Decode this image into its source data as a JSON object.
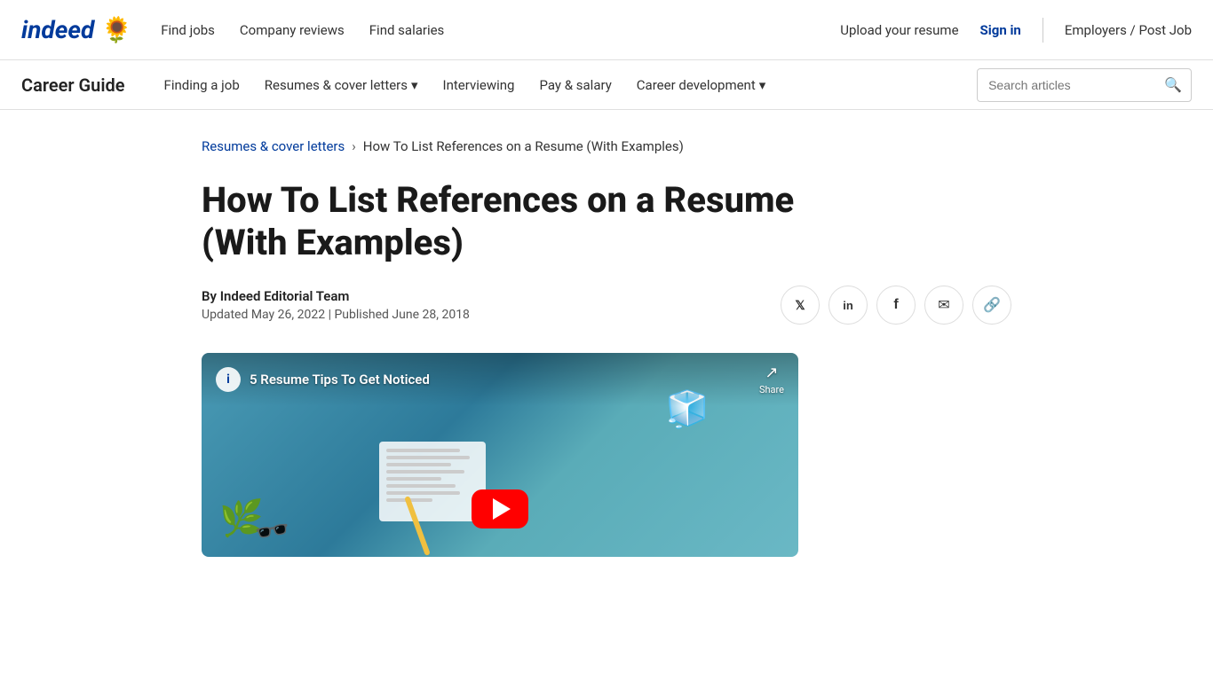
{
  "topNav": {
    "logo_text": "indeed",
    "logo_flower": "🌻",
    "links": [
      {
        "id": "find-jobs",
        "label": "Find jobs"
      },
      {
        "id": "company-reviews",
        "label": "Company reviews"
      },
      {
        "id": "find-salaries",
        "label": "Find salaries"
      }
    ],
    "right": {
      "upload_resume": "Upload your resume",
      "sign_in": "Sign in",
      "employers": "Employers / Post Job"
    }
  },
  "secondaryNav": {
    "title": "Career Guide",
    "links": [
      {
        "id": "finding-job",
        "label": "Finding a job",
        "hasDropdown": false
      },
      {
        "id": "resumes-cover-letters",
        "label": "Resumes & cover letters",
        "hasDropdown": true
      },
      {
        "id": "interviewing",
        "label": "Interviewing",
        "hasDropdown": false
      },
      {
        "id": "pay-salary",
        "label": "Pay & salary",
        "hasDropdown": false
      },
      {
        "id": "career-development",
        "label": "Career development",
        "hasDropdown": true
      }
    ],
    "search": {
      "placeholder": "Search articles"
    }
  },
  "breadcrumb": {
    "parent_label": "Resumes & cover letters",
    "current_label": "How To List References on a Resume (With Examples)"
  },
  "article": {
    "title": "How To List References on a Resume (With Examples)",
    "author": "By Indeed Editorial Team",
    "updated": "Updated May 26, 2022",
    "separator": "|",
    "published": "Published June 28, 2018"
  },
  "shareButtons": [
    {
      "id": "twitter",
      "icon": "𝕏",
      "label": "Share on Twitter"
    },
    {
      "id": "linkedin",
      "icon": "in",
      "label": "Share on LinkedIn"
    },
    {
      "id": "facebook",
      "icon": "f",
      "label": "Share on Facebook"
    },
    {
      "id": "email",
      "icon": "✉",
      "label": "Share via Email"
    },
    {
      "id": "copy-link",
      "icon": "🔗",
      "label": "Copy link"
    }
  ],
  "video": {
    "info_icon": "i",
    "title": "5 Resume Tips To Get Noticed",
    "share_label": "Share"
  },
  "colors": {
    "brand_blue": "#003a9b",
    "link_blue": "#003a9b",
    "red": "#ff0000"
  }
}
